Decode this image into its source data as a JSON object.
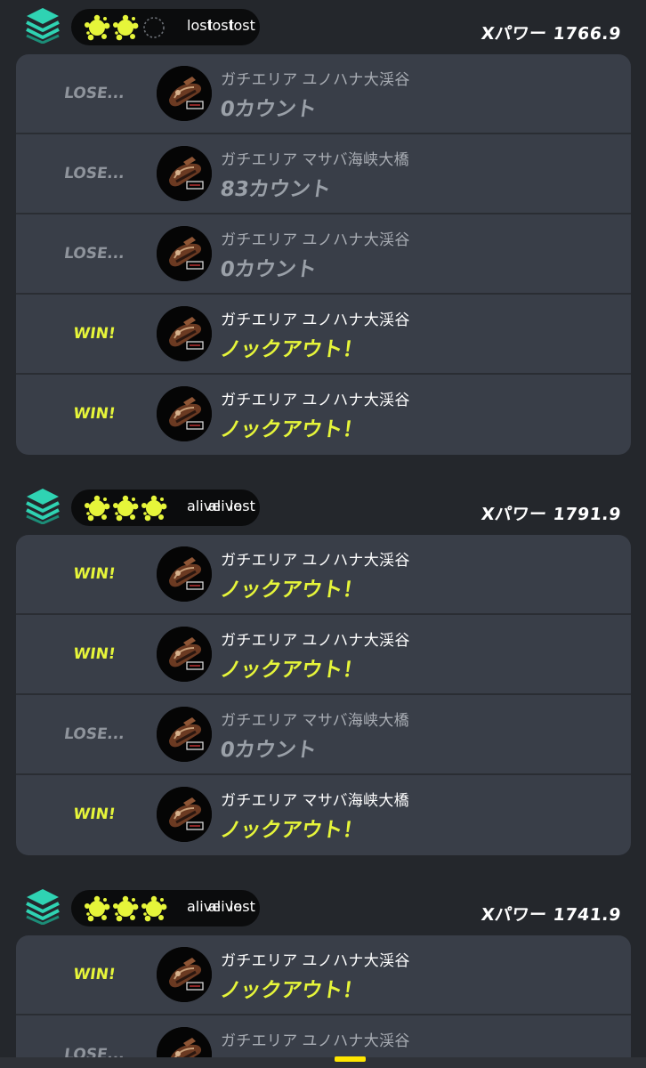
{
  "series": [
    {
      "xpower": "Xパワー 1766.9",
      "ink_wins": [
        true,
        true,
        false
      ],
      "lives": [
        "lost",
        "lost",
        "lost"
      ],
      "matches": [
        {
          "result": "LOSE...",
          "stage": "ガチエリア ユノハナ大渓谷",
          "score": "0カウント",
          "won": false
        },
        {
          "result": "LOSE...",
          "stage": "ガチエリア マサバ海峡大橋",
          "score": "83カウント",
          "won": false
        },
        {
          "result": "LOSE...",
          "stage": "ガチエリア ユノハナ大渓谷",
          "score": "0カウント",
          "won": false
        },
        {
          "result": "WIN!",
          "stage": "ガチエリア ユノハナ大渓谷",
          "score": "ノックアウト！",
          "won": true
        },
        {
          "result": "WIN!",
          "stage": "ガチエリア ユノハナ大渓谷",
          "score": "ノックアウト！",
          "won": true
        }
      ]
    },
    {
      "xpower": "Xパワー 1791.9",
      "ink_wins": [
        true,
        true,
        true
      ],
      "lives": [
        "alive",
        "alive",
        "lost"
      ],
      "matches": [
        {
          "result": "WIN!",
          "stage": "ガチエリア ユノハナ大渓谷",
          "score": "ノックアウト！",
          "won": true
        },
        {
          "result": "WIN!",
          "stage": "ガチエリア ユノハナ大渓谷",
          "score": "ノックアウト！",
          "won": true
        },
        {
          "result": "LOSE...",
          "stage": "ガチエリア マサバ海峡大橋",
          "score": "0カウント",
          "won": false
        },
        {
          "result": "WIN!",
          "stage": "ガチエリア マサバ海峡大橋",
          "score": "ノックアウト！",
          "won": true
        }
      ]
    },
    {
      "xpower": "Xパワー 1741.9",
      "ink_wins": [
        true,
        true,
        true
      ],
      "lives": [
        "alive",
        "alive",
        "lost"
      ],
      "matches": [
        {
          "result": "WIN!",
          "stage": "ガチエリア ユノハナ大渓谷",
          "score": "ノックアウト！",
          "won": true
        },
        {
          "result": "LOSE...",
          "stage": "ガチエリア ユノハナ大渓谷",
          "score": "",
          "won": false
        }
      ]
    }
  ],
  "colors": {
    "background": "#24272c",
    "card": "#393e48",
    "win": "#e6f53a",
    "lose": "#8f949c",
    "life_alive": "#f5864a",
    "stack_icon": "#2fd3b3",
    "nav_indicator": "#ffe600"
  },
  "icons": {
    "mode": "x-match-stack-icon",
    "win_mark": "ink-splat-icon",
    "empty_mark": "empty-circle-icon",
    "life": "squid-icon",
    "weapon": "weapon-icon"
  }
}
